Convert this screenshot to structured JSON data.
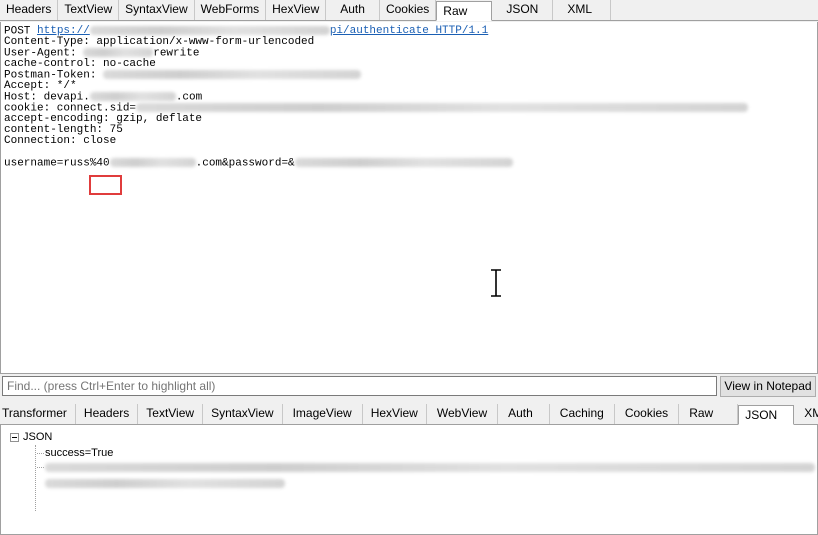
{
  "request_tabs": [
    "Headers",
    "TextView",
    "SyntaxView",
    "WebForms",
    "HexView",
    "Auth",
    "Cookies",
    "Raw",
    "JSON",
    "XML"
  ],
  "request_active_tab": "Raw",
  "raw": {
    "method": "POST ",
    "url_prefix": "https://",
    "url_suffix": "pi/authenticate HTTP/1.1",
    "content_type": "Content-Type: application/x-www-form-urlencoded",
    "user_agent_label": "User-Agent: ",
    "user_agent_tail": "rewrite",
    "cache_control": "cache-control: no-cache",
    "postman_token_label": "Postman-Token: ",
    "accept": "Accept: */*",
    "host_label": "Host: devapi.",
    "host_tail": ".com",
    "cookie_label": "cookie: connect.sid=",
    "accept_encoding": "accept-encoding: gzip, deflate",
    "content_length": "content-length: 75",
    "connection": "Connection: close",
    "body_prefix": "username=rus",
    "body_highlight": "s%40",
    "body_middle": ".com&password=",
    "body_tail": "&"
  },
  "find": {
    "placeholder": "Find... (press Ctrl+Enter to highlight all)",
    "notepad_button": "View in Notepad"
  },
  "response_tabs": [
    "Transformer",
    "Headers",
    "TextView",
    "SyntaxView",
    "ImageView",
    "HexView",
    "WebView",
    "Auth",
    "Caching",
    "Cookies",
    "Raw",
    "JSON",
    "XML"
  ],
  "response_active_tab": "JSON",
  "json_tree": {
    "root": "JSON",
    "children": [
      "success=True"
    ]
  },
  "colors": {
    "highlight_box": "#e03c3c",
    "link": "#1a5fb4"
  }
}
